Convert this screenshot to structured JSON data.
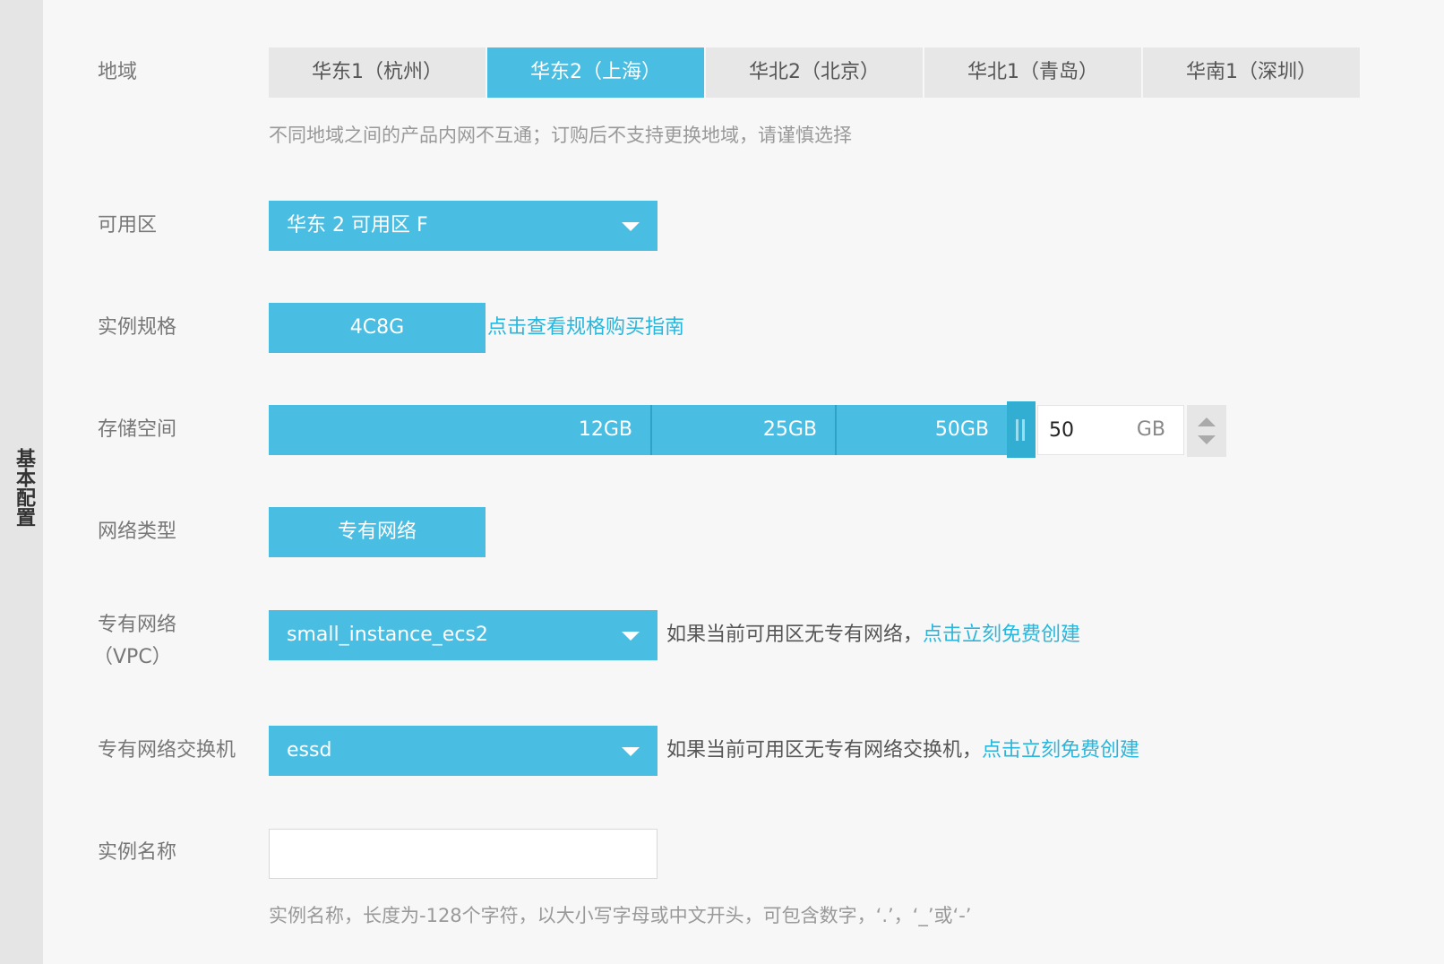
{
  "sidebar": {
    "title": "基本配置"
  },
  "region": {
    "label": "地域",
    "tabs": [
      "华东1（杭州）",
      "华东2（上海）",
      "华北2（北京）",
      "华北1（青岛）",
      "华南1（深圳）"
    ],
    "selected": "华东2（上海）",
    "note": "不同地域之间的产品内网不互通；订购后不支持更换地域，请谨慎选择"
  },
  "zone": {
    "label": "可用区",
    "value": "华东 2 可用区 F"
  },
  "spec": {
    "label": "实例规格",
    "value": "4C8G",
    "guide_link": "点击查看规格购买指南"
  },
  "storage": {
    "label": "存储空间",
    "ticks": [
      "12GB",
      "25GB",
      "50GB"
    ],
    "value": "50",
    "unit": "GB",
    "slider_fill": 1.0
  },
  "network_type": {
    "label": "网络类型",
    "value": "专有网络"
  },
  "vpc": {
    "label_line1": "专有网络",
    "label_line2": "（VPC）",
    "value": "small_instance_ecs2",
    "help": "如果当前可用区无专有网络，",
    "link": "点击立刻免费创建"
  },
  "vswitch": {
    "label": "专有网络交换机",
    "value": "essd",
    "help": "如果当前可用区无专有网络交换机，",
    "link": "点击立刻免费创建"
  },
  "instance_name": {
    "label": "实例名称",
    "value": "",
    "note": "实例名称，长度为-128个字符，以大小写字母或中文开头，可包含数字，‘.’，‘_’或‘-’"
  },
  "colors": {
    "accent": "#49bee2",
    "link": "#29b6dc",
    "tab_bg": "#e7e7e7"
  },
  "icons": {
    "select_caret": "caret-down-icon",
    "slider_handle": "grip-icon",
    "stepper": "arrow-up-down-icon"
  }
}
